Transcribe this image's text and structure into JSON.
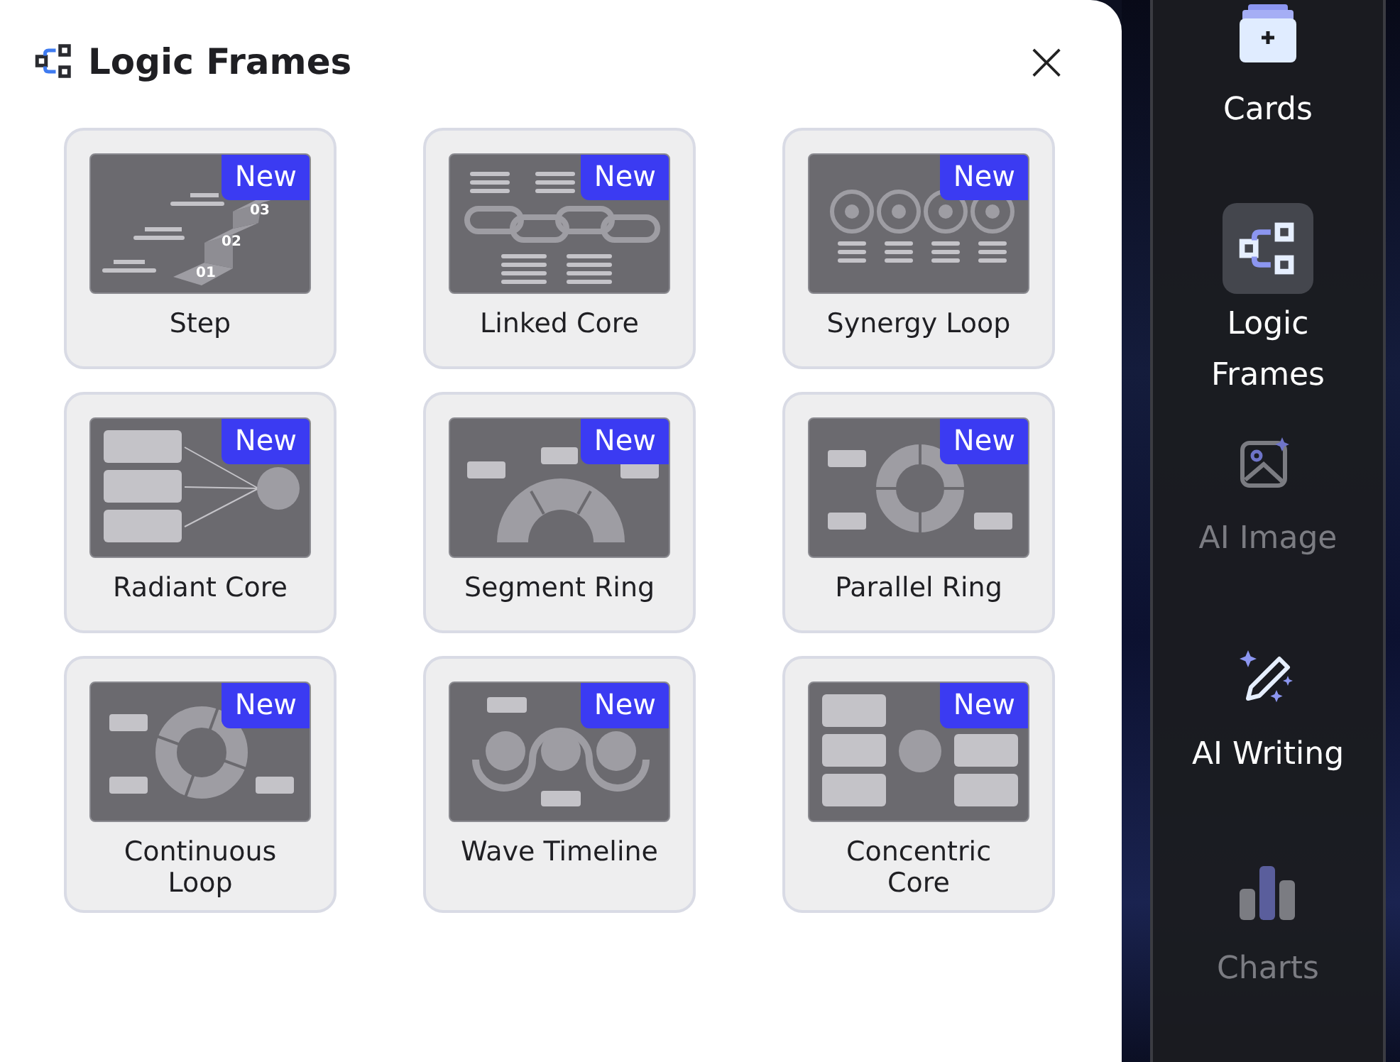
{
  "panel": {
    "title": "Logic Frames",
    "close": "×"
  },
  "frames": [
    {
      "kind": "step",
      "label": "Step",
      "badge": "New",
      "labels": [
        "01",
        "02",
        "03"
      ]
    },
    {
      "kind": "linked",
      "label": "Linked Core",
      "badge": "New"
    },
    {
      "kind": "synergy",
      "label": "Synergy Loop",
      "badge": "New"
    },
    {
      "kind": "radiant",
      "label": "Radiant Core",
      "badge": "New"
    },
    {
      "kind": "segment",
      "label": "Segment Ring",
      "badge": "New"
    },
    {
      "kind": "parallel",
      "label": "Parallel Ring",
      "badge": "New"
    },
    {
      "kind": "continuous",
      "label": "Continuous Loop",
      "badge": "New"
    },
    {
      "kind": "wave",
      "label": "Wave Timeline",
      "badge": "New"
    },
    {
      "kind": "concentric",
      "label": "Concentric Core",
      "badge": "New"
    }
  ],
  "sidebar": {
    "items": [
      {
        "kind": "cards",
        "label": "Cards",
        "selected": false,
        "disabled": false
      },
      {
        "kind": "logic",
        "label": "Logic Frames",
        "selected": true,
        "disabled": false
      },
      {
        "kind": "image",
        "label": "AI Image",
        "selected": false,
        "disabled": true
      },
      {
        "kind": "writing",
        "label": "AI Writing",
        "selected": false,
        "disabled": false
      },
      {
        "kind": "charts",
        "label": "Charts",
        "selected": false,
        "disabled": true
      }
    ]
  }
}
